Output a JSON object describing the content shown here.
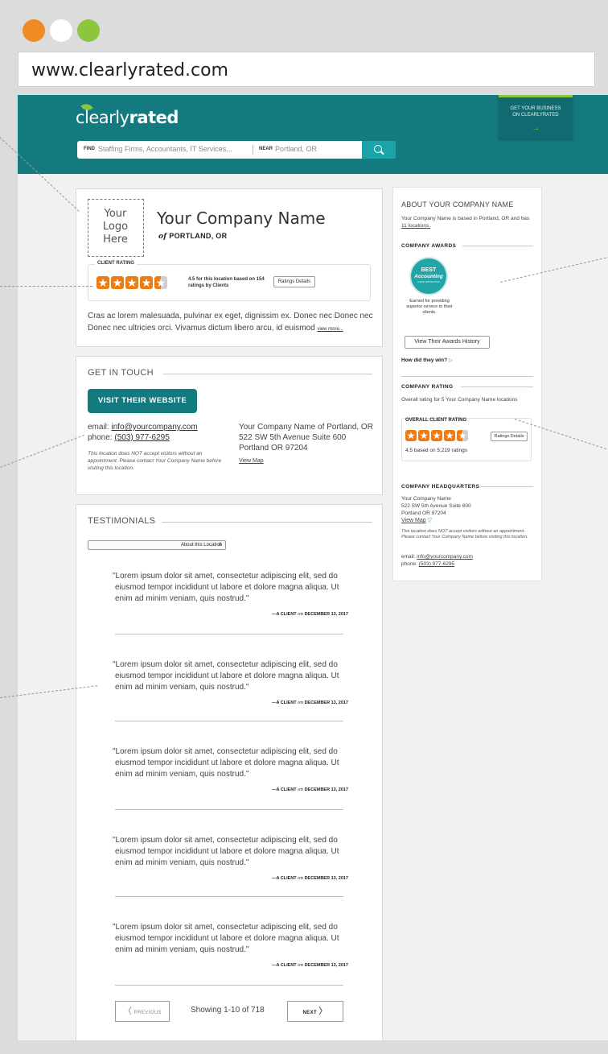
{
  "window": {
    "url": "www.clearlyrated.com",
    "dot_colors": [
      "#f08a24",
      "#ffffff",
      "#8cc63f"
    ]
  },
  "header": {
    "logo_prefix": "clearly",
    "logo_suffix": "rated",
    "cta_line1": "GET YOUR BUSINESS",
    "cta_line2": "ON CLEARLYRATED",
    "cta_arrow": "→",
    "search": {
      "find_label": "FIND",
      "find_value": "Staffing Firms, Accountants, IT Services...",
      "near_label": "NEAR",
      "near_value": "Portland, OR"
    },
    "colors": {
      "teal": "#137b80",
      "accent": "#8cc63f"
    }
  },
  "profile": {
    "logo_placeholder": "Your\nLogo\nHere",
    "company_name": "Your Company Name",
    "location_of": "of",
    "location": "PORTLAND, OR",
    "rating_title": "CLIENT RATING",
    "rating_value": 4.5,
    "rating_text": "4.5 for this location based on 154 ratings by Clients",
    "ratings_details": "Ratings Details",
    "description": "Cras ac lorem malesuada, pulvinar ex eget, dignissim ex. Donec nec Donec nec Donec nec ultricies orci. Vivamus dictum libero arcu, id euismod",
    "view_more": "view more..."
  },
  "contact": {
    "title": "GET IN TOUCH",
    "visit_button": "VISIT THEIR WEBSITE",
    "email_label": "email:",
    "email": "info@yourcompany.com",
    "phone_label": "phone:",
    "phone": "(503) 977-6295",
    "note": "This location does NOT accept visitors without an appointment. Please contact Your Company Name before visiting this location.",
    "address_line1": "Your Company Name of Portland, OR",
    "address_line2": "522 SW 5th Avenue Suite 600",
    "address_line3": "Portland OR 97204",
    "view_map": "View Map"
  },
  "testimonials": {
    "title": "TESTIMONIALS",
    "filter": "About this Location",
    "filter_arrow": "⇕",
    "items": [
      {
        "quote": "\"Lorem ipsum dolor sit amet, consectetur adipiscing elit, sed do eiusmod tempor incididunt ut labore et dolore magna aliqua. Ut enim ad minim veniam, quis nostrud.\"",
        "author": "—A CLIENT",
        "on": "on",
        "date": "DECEMBER 13, 2017"
      },
      {
        "quote": "\"Lorem ipsum dolor sit amet, consectetur adipiscing elit, sed do eiusmod tempor incididunt ut labore et dolore magna aliqua. Ut enim ad minim veniam, quis nostrud.\"",
        "author": "—A CLIENT",
        "on": "on",
        "date": "DECEMBER 13, 2017"
      },
      {
        "quote": "\"Lorem ipsum dolor sit amet, consectetur adipiscing elit, sed do eiusmod tempor incididunt ut labore et dolore magna aliqua. Ut enim ad minim veniam, quis nostrud.\"",
        "author": "—A CLIENT",
        "on": "on",
        "date": "DECEMBER 13, 2017"
      },
      {
        "quote": "\"Lorem ipsum dolor sit amet, consectetur adipiscing elit, sed do eiusmod tempor incididunt ut labore et dolore magna aliqua. Ut enim ad minim veniam, quis nostrud.\"",
        "author": "—A CLIENT",
        "on": "on",
        "date": "DECEMBER 13, 2017"
      },
      {
        "quote": "\"Lorem ipsum dolor sit amet, consectetur adipiscing elit, sed do eiusmod tempor incididunt ut labore et dolore magna aliqua. Ut enim ad minim veniam, quis nostrud.\"",
        "author": "—A CLIENT",
        "on": "on",
        "date": "DECEMBER 13, 2017"
      }
    ],
    "previous": "PREVIOUS",
    "next": "NEXT",
    "showing": "Showing 1-10 of 718"
  },
  "sidebar": {
    "about_title": "ABOUT YOUR COMPANY NAME",
    "about_text": "Your Company Name is based in Portland, OR and has",
    "locations_link": "11 locations.",
    "awards_title": "COMPANY AWARDS",
    "badge_line1": "BEST",
    "badge_line2": "Accounting",
    "badge_line3": "CLIENT SATISFACTION",
    "earned_text": "Earned for providing superior service to their clients.",
    "awards_button": "View Their Awards History",
    "how_win": "How did they win?",
    "how_win_arrow": "▷",
    "rating_title": "COMPANY RATING",
    "rating_text": "Overall rating for 5 Your Company Name locations",
    "overall_title": "OVERALL CLIENT RATING",
    "overall_value": 4.5,
    "overall_text": "4.5 based on 5,219 ratings",
    "ratings_details": "Ratings Details",
    "hq_title": "COMPANY HEADQUARTERS",
    "hq_line1": "Your Company Name",
    "hq_line2": "522 SW 5th Avenue Suite 600",
    "hq_line3": "Portland OR 97204",
    "hq_map": "View Map",
    "hq_map_arrow": "▽",
    "hq_note": "This location does NOT accept visitors without an appointment. Please contact Your Company Name before visiting this location.",
    "email_label": "email:",
    "email": "info@yourcompany.com",
    "phone_label": "phone:",
    "phone": "(503) 977-6295"
  }
}
